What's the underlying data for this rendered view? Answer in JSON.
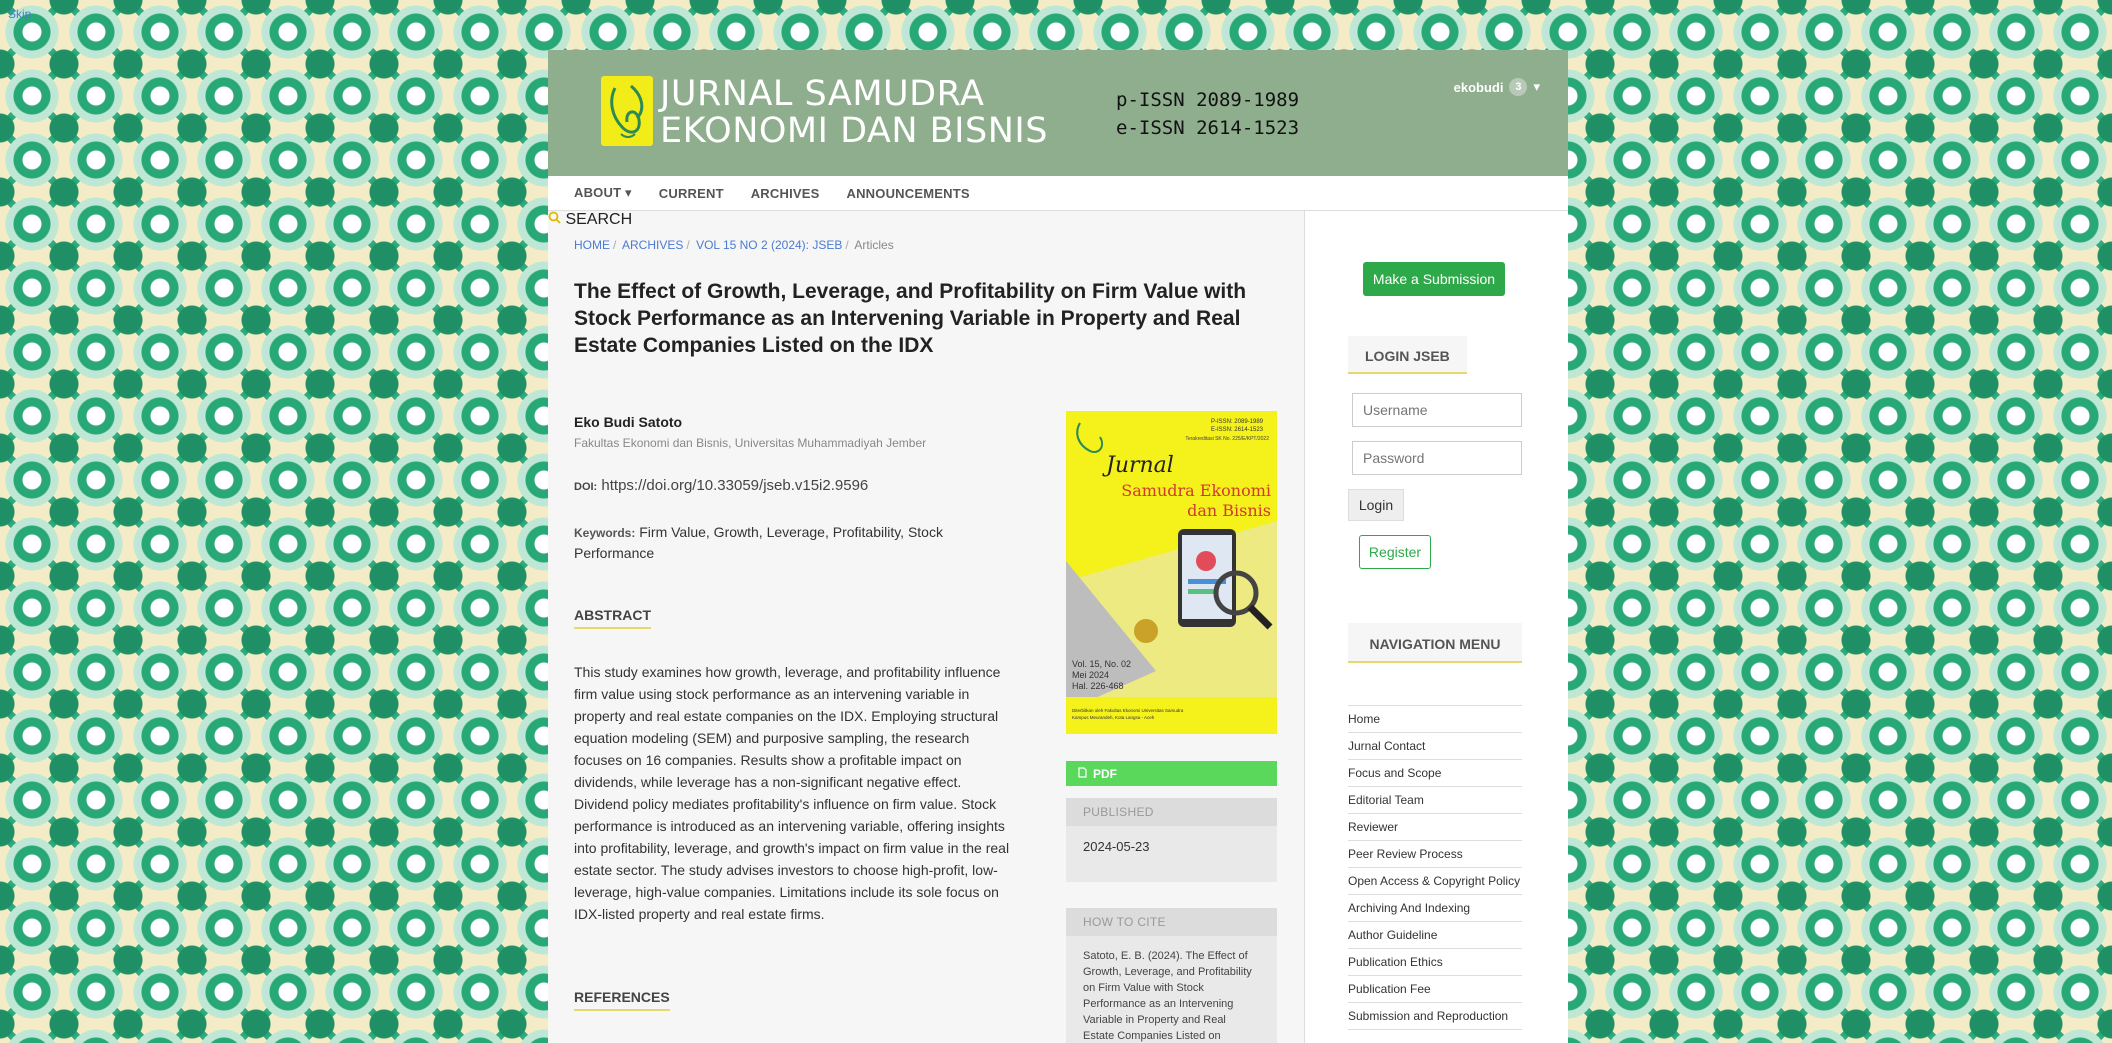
{
  "skip_link": "Skip",
  "header": {
    "title_line1": "JURNAL SAMUDRA",
    "title_line2": "EKONOMI DAN BISNIS",
    "pissn": "p-ISSN 2089-1989",
    "eissn": "e-ISSN 2614-1523",
    "user": "ekobudi",
    "notification_count": "3"
  },
  "nav": {
    "items": [
      "ABOUT ▾",
      "CURRENT",
      "ARCHIVES",
      "ANNOUNCEMENTS"
    ],
    "search": "SEARCH"
  },
  "breadcrumb": [
    "HOME",
    "ARCHIVES",
    "VOL 15 NO 2 (2024): JSEB",
    "Articles"
  ],
  "article": {
    "title": "The Effect of Growth, Leverage, and Profitability on Firm Value with Stock Performance as an Intervening Variable in Property and Real Estate Companies Listed on the IDX",
    "author": "Eko Budi Satoto",
    "affiliation": "Fakultas Ekonomi dan Bisnis, Universitas Muhammadiyah Jember",
    "doi_label": "DOI:",
    "doi": "https://doi.org/10.33059/jseb.v15i2.9596",
    "keywords_label": "Keywords:",
    "keywords": "Firm Value, Growth, Leverage, Profitability, Stock Performance",
    "abstract_heading": "ABSTRACT",
    "abstract": "This study examines how growth, leverage, and profitability influence firm value using stock performance as an intervening variable in property and real estate companies on the IDX. Employing structural equation modeling (SEM) and purposive sampling, the research focuses on 16 companies. Results show a profitable impact on dividends, while leverage has a non-significant negative effect. Dividend policy mediates profitability's influence on firm value. Stock performance is introduced as an intervening variable, offering insights into profitability, leverage, and growth's impact on firm value in the real estate sector. The study advises investors to choose high-profit, low-leverage, high-value companies. Limitations include its sole focus on IDX-listed property and real estate firms.",
    "references_heading": "REFERENCES"
  },
  "cover": {
    "issn_p": "P-ISSN: 2089-1989",
    "issn_e": "E-ISSN: 2614-1523",
    "accreditation": "Terakreditasi SK No. 225/E/KPT/2022",
    "word1": "Jurnal",
    "word2": "Samudra Ekonomi",
    "word3": "dan Bisnis",
    "vol": "Vol. 15, No. 02",
    "date": "Mei 2024",
    "pages": "Hal. 226-468",
    "publisher": "Diterbitkan oleh Fakultas Ekonomi Universitas Samudra",
    "address": "Kampus Meurandeh, Kota Langsa - Aceh"
  },
  "pdf_label": "PDF",
  "published": {
    "title": "PUBLISHED",
    "value": "2024-05-23"
  },
  "cite": {
    "title": "HOW TO CITE",
    "text": "Satoto, E. B. (2024). The Effect of Growth, Leverage, and Profitability on Firm Value with Stock Performance as an Intervening Variable in Property and Real Estate Companies Listed on"
  },
  "sidebar": {
    "submit": "Make a Submission",
    "login_heading": "LOGIN JSEB",
    "username_placeholder": "Username",
    "password_placeholder": "Password",
    "login": "Login",
    "register": "Register",
    "nav_heading": "NAVIGATION MENU",
    "menu": [
      "Home",
      "Jurnal Contact",
      "Focus and Scope",
      "Editorial Team",
      "Reviewer",
      "Peer Review Process",
      "Open Access & Copyright Policy",
      "Archiving And Indexing",
      "Author Guideline",
      "Publication Ethics",
      "Publication Fee",
      "Submission and Reproduction"
    ]
  },
  "colors": {
    "header_bg": "#8fae8d",
    "accent_green": "#2ea94a",
    "pdf_green": "#5ad85b",
    "underline": "#e6d86d",
    "cover_yellow": "#f5f11a"
  }
}
